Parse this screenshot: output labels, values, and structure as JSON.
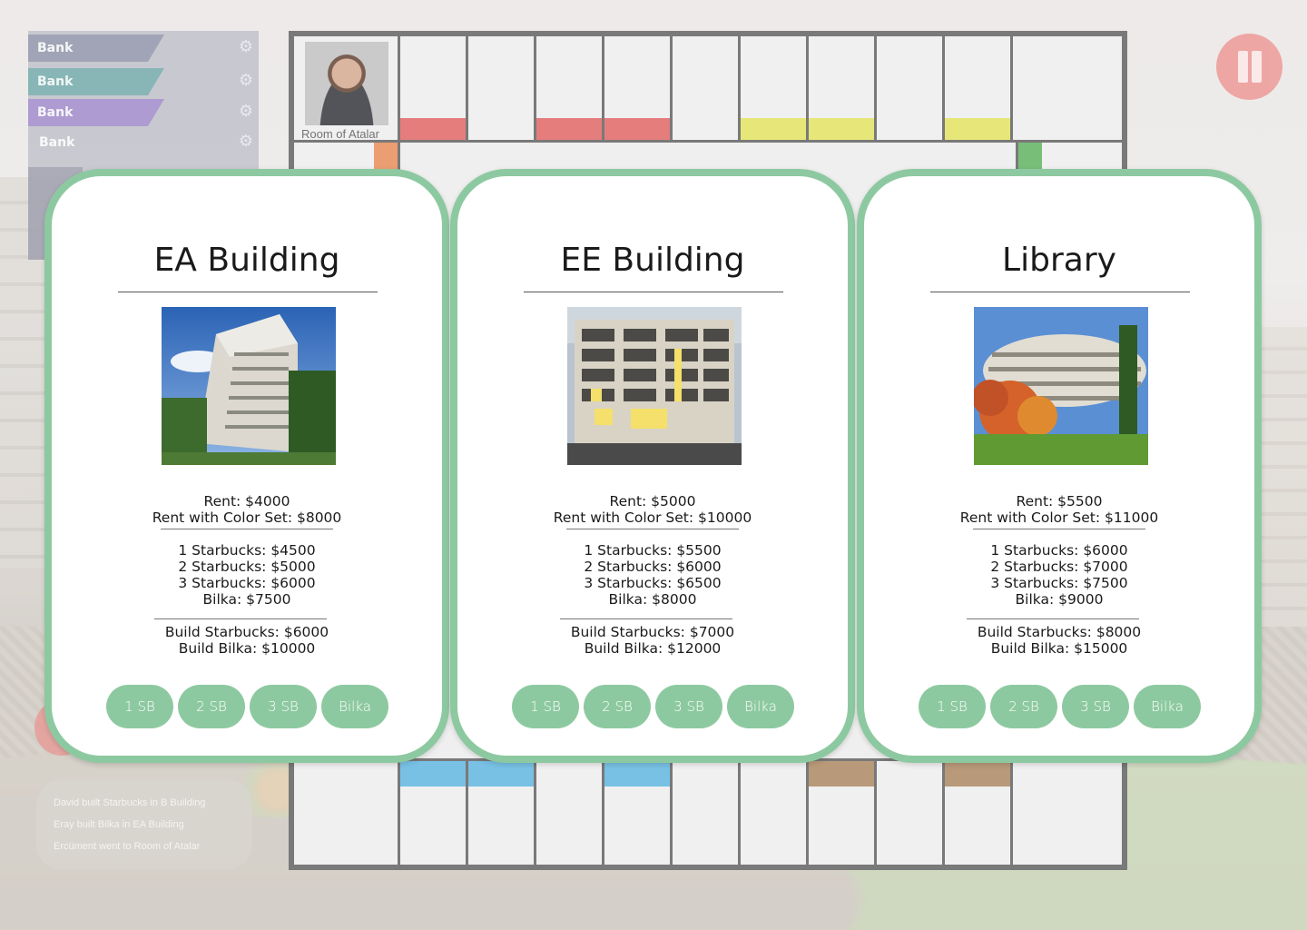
{
  "players": [
    {
      "name": "Bank",
      "color": "#8d91a6"
    },
    {
      "name": "Bank",
      "color": "#6ea6a6"
    },
    {
      "name": "Bank",
      "color": "#9d86c7"
    },
    {
      "name": "Bank",
      "color": "#9fa1ad"
    }
  ],
  "corner": {
    "label": "Room of Atalar"
  },
  "top_strip_colors": [
    "",
    "#e06161",
    "",
    "#e06161",
    "#e06161",
    "",
    "#e1e25b",
    "#e1e25b",
    "",
    "#e1e25b",
    ""
  ],
  "bottom_strip_colors": [
    "",
    "#5bb4df",
    "#5bb4df",
    "",
    "#5bb4df",
    "",
    "",
    "#a9835c",
    "",
    "#a9835c",
    ""
  ],
  "log": [
    "David built Starbucks in B Building",
    "Eray built Bilka in EA Building",
    "Ercüment went to Room of Atalar"
  ],
  "cards": [
    {
      "title": "EA Building",
      "rent": "Rent: $4000",
      "rent_color_set": "Rent with Color Set: $8000",
      "sb1": "1 Starbucks: $4500",
      "sb2": "2 Starbucks: $5000",
      "sb3": "3 Starbucks: $6000",
      "bilka": "Bilka: $7500",
      "build_sb": "Build Starbucks: $6000",
      "build_bilka": "Build Bilka: $10000",
      "buttons": [
        "1 SB",
        "2 SB",
        "3 SB",
        "Bilka"
      ],
      "photo": "ea-building"
    },
    {
      "title": "EE Building",
      "rent": "Rent: $5000",
      "rent_color_set": "Rent with Color Set: $10000",
      "sb1": "1 Starbucks: $5500",
      "sb2": "2 Starbucks: $6000",
      "sb3": "3 Starbucks: $6500",
      "bilka": "Bilka: $8000",
      "build_sb": "Build Starbucks: $7000",
      "build_bilka": "Build Bilka: $12000",
      "buttons": [
        "1 SB",
        "2 SB",
        "3 SB",
        "Bilka"
      ],
      "photo": "ee-building"
    },
    {
      "title": "Library",
      "rent": "Rent: $5500",
      "rent_color_set": "Rent with Color Set: $11000",
      "sb1": "1 Starbucks: $6000",
      "sb2": "2 Starbucks: $7000",
      "sb3": "3 Starbucks: $7500",
      "bilka": "Bilka: $9000",
      "build_sb": "Build Starbucks: $8000",
      "build_bilka": "Build Bilka: $15000",
      "buttons": [
        "1 SB",
        "2 SB",
        "3 SB",
        "Bilka"
      ],
      "photo": "library"
    }
  ],
  "accent_color": "#8dc9a0",
  "icons": {
    "settings": "gear-icon",
    "pause": "pause-icon"
  }
}
